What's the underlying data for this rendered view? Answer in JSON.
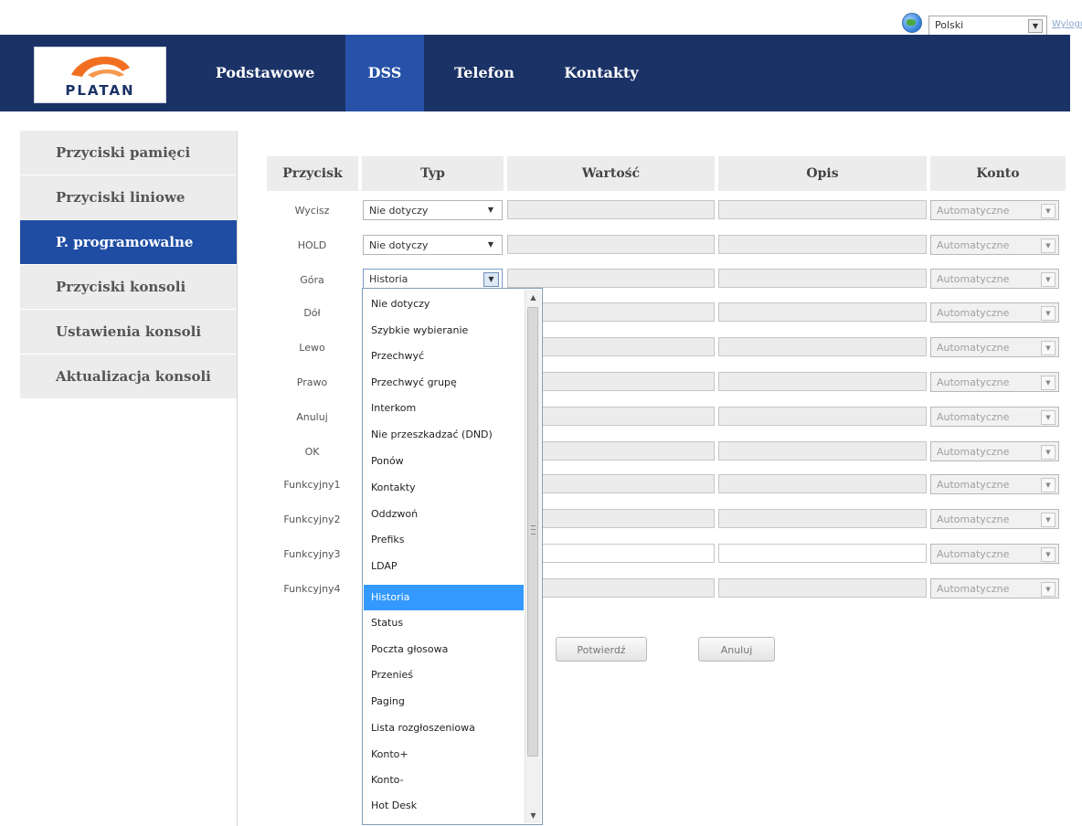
{
  "topbar": {
    "language": "Polski",
    "logout_label": "Wyloguj",
    "globe_icon": "globe-icon"
  },
  "logo": {
    "text": "PLATAN",
    "swoosh_color": "#f26f21"
  },
  "nav": [
    {
      "label": "Podstawowe",
      "active": false
    },
    {
      "label": "DSS",
      "active": true
    },
    {
      "label": "Telefon",
      "active": false
    },
    {
      "label": "Kontakty",
      "active": false
    }
  ],
  "sidebar": [
    {
      "label": "Przyciski pamięci",
      "active": false
    },
    {
      "label": "Przyciski liniowe",
      "active": false
    },
    {
      "label": "P. programowalne",
      "active": true
    },
    {
      "label": "Przyciski konsoli",
      "active": false
    },
    {
      "label": "Ustawienia konsoli",
      "active": false
    },
    {
      "label": "Aktualizacja konsoli",
      "active": false
    }
  ],
  "table": {
    "headers": {
      "przycisk": "Przycisk",
      "typ": "Typ",
      "wartosc": "Wartość",
      "opis": "Opis",
      "konto": "Konto"
    },
    "rows": [
      {
        "label": "Wycisz",
        "type": "Nie dotyczy",
        "konto": "Automatyczne"
      },
      {
        "label": "HOLD",
        "type": "Nie dotyczy",
        "konto": "Automatyczne"
      },
      {
        "label": "Góra",
        "type": "Historia",
        "konto": "Automatyczne"
      },
      {
        "label": "Dół",
        "konto": "Automatyczne"
      },
      {
        "label": "Lewo",
        "konto": "Automatyczne"
      },
      {
        "label": "Prawo",
        "konto": "Automatyczne"
      },
      {
        "label": "Anuluj",
        "konto": "Automatyczne"
      },
      {
        "label": "OK",
        "konto": "Automatyczne"
      },
      {
        "label": "Funkcyjny1",
        "konto": "Automatyczne"
      },
      {
        "label": "Funkcyjny2",
        "konto": "Automatyczne"
      },
      {
        "label": "Funkcyjny3",
        "konto": "Automatyczne"
      },
      {
        "label": "Funkcyjny4",
        "konto": "Automatyczne"
      }
    ]
  },
  "dropdown": {
    "selected": "Historia",
    "options": [
      "Nie dotyczy",
      "Szybkie wybieranie",
      "Przechwyć",
      "Przechwyć grupę",
      "Interkom",
      "Nie przeszkadzać (DND)",
      "Ponów",
      "Kontakty",
      "Oddzwoń",
      "Prefiks",
      "LDAP",
      "Historia",
      "Status",
      "Poczta głosowa",
      "Przenieś",
      "Paging",
      "Lista rozgłoszeniowa",
      "Konto+",
      "Konto-",
      "Hot Desk"
    ]
  },
  "buttons": {
    "confirm": "Potwierdź",
    "cancel": "Anuluj"
  }
}
